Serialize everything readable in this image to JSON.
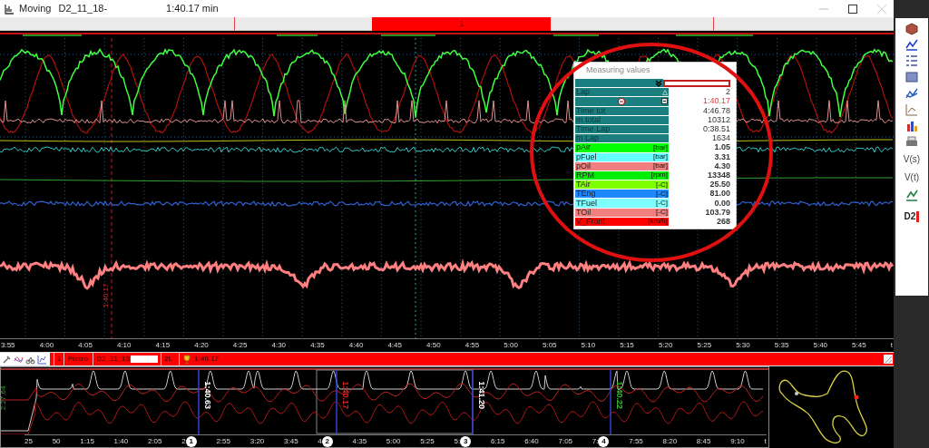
{
  "window": {
    "title": "Moving",
    "file": "D2_11_18-",
    "duration": "1:40.17 min"
  },
  "segment_bar": {
    "segments": [
      {
        "selected": false
      },
      {
        "selected": false
      },
      {
        "label": "1",
        "selected": true
      },
      {
        "selected": false
      },
      {
        "selected": false
      }
    ]
  },
  "chart": {
    "cursor_label": "1:40.17",
    "xticks": [
      "3:55",
      "4:00",
      "4:05",
      "4:10",
      "4:15",
      "4:20",
      "4:25",
      "4:30",
      "4:35",
      "4:40",
      "4:45",
      "4:50",
      "4:55",
      "5:00",
      "5:05",
      "5:10",
      "5:15",
      "5:20",
      "5:25",
      "5:30",
      "5:35",
      "5:40",
      "5:45",
      "t"
    ]
  },
  "measuring_values": {
    "title": "Measuring values",
    "rows": [
      {
        "kind": "header",
        "color": "#1b7f80"
      },
      {
        "kind": "info",
        "label": "Lap",
        "value": "2",
        "color": "#1b7f80"
      },
      {
        "kind": "timer",
        "value": "1:40.17",
        "color": "#1b7f80"
      },
      {
        "kind": "info",
        "label": "Time tot",
        "value": "4:46.78",
        "color": "#1b7f80"
      },
      {
        "kind": "info",
        "label": "m total",
        "value": "10312",
        "color": "#1b7f80"
      },
      {
        "kind": "info",
        "label": "Time Lap",
        "value": "0:38.51",
        "color": "#1b7f80"
      },
      {
        "kind": "info",
        "label": "m Lap",
        "value": "1634",
        "color": "#1b7f80"
      },
      {
        "kind": "channel",
        "label": "pAir",
        "unit": "[bar]",
        "value": "1.05",
        "color": "#00ff00"
      },
      {
        "kind": "channel",
        "label": "pFuel",
        "unit": "[bar]",
        "value": "3.31",
        "color": "#66ffff"
      },
      {
        "kind": "channel",
        "label": "pOil",
        "unit": "[bar]",
        "value": "4.30",
        "color": "#f08080"
      },
      {
        "kind": "channel",
        "label": "RPM",
        "unit": "[rpm]",
        "value": "13348",
        "color": "#00ee00"
      },
      {
        "kind": "channel",
        "label": "TAir",
        "unit": "[-C]",
        "value": "25.50",
        "color": "#80ff00"
      },
      {
        "kind": "channel",
        "label": "TEng",
        "unit": "[-C]",
        "value": "81.00",
        "color": "#1e88ff"
      },
      {
        "kind": "channel",
        "label": "TFuel",
        "unit": "[-C]",
        "value": "0.00",
        "color": "#80ffff"
      },
      {
        "kind": "channel",
        "label": "TOil",
        "unit": "[-C]",
        "value": "103.79",
        "color": "#f08080"
      },
      {
        "kind": "channel",
        "label": "V_Front",
        "unit": "[km/h]",
        "value": "268",
        "color": "#ff0000"
      }
    ]
  },
  "info_bar": {
    "lap": "1",
    "driver": "Pietro",
    "session": "D2_11_18",
    "position": "2l.",
    "best_lap": "1:40.17"
  },
  "overview": {
    "y_label": "2:27.64",
    "xticks": [
      "25",
      "50",
      "1:15",
      "1:40",
      "2:05",
      "2",
      "2:55",
      "3:20",
      "3:45",
      "4",
      "4:35",
      "5:00",
      "5:25",
      "5:",
      "6:15",
      "6:40",
      "7:05",
      "7:",
      "7:55",
      "8:20",
      "8:45",
      "9:10",
      "t"
    ],
    "laps": [
      {
        "marker": "1",
        "time": "1:40.63",
        "color": "#ffffff"
      },
      {
        "marker": "2",
        "time": "1:40.17",
        "color": "#e02020"
      },
      {
        "marker": "3",
        "time": "1:41.20",
        "color": "#ffffff"
      },
      {
        "marker": "4",
        "time": "1:40.22",
        "color": "#33bb33"
      }
    ]
  },
  "toolbar": {
    "text_buttons": [
      "V(s)",
      "V(t)"
    ],
    "badge": "D2"
  }
}
